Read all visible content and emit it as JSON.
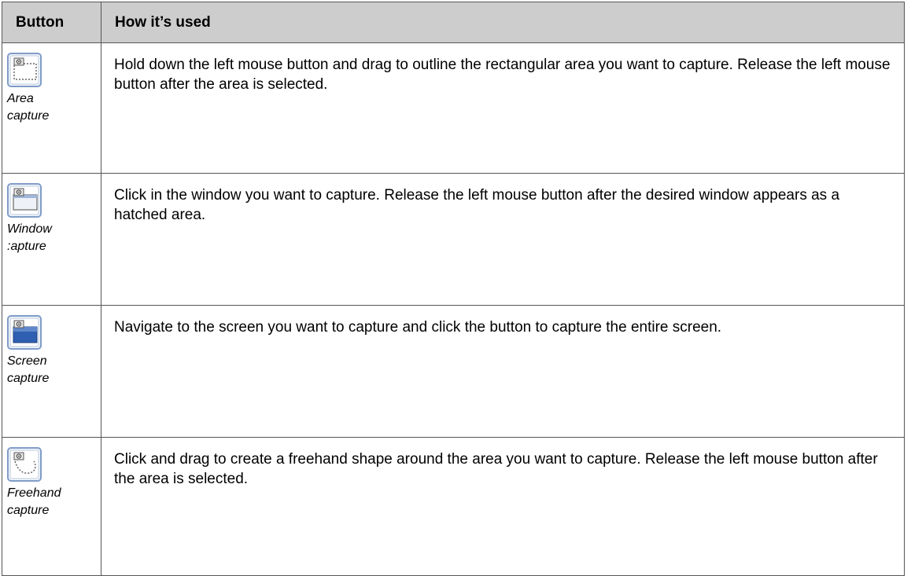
{
  "table": {
    "headers": {
      "button": "Button",
      "usage": "How it’s used"
    },
    "rows": [
      {
        "icon": "area-capture-icon",
        "caption": "Area\ncapture",
        "description": "Hold down the left mouse button and drag to outline the rectangular area you want to capture. Release the left mouse button after the area is selected."
      },
      {
        "icon": "window-capture-icon",
        "caption": " Window\n:apture",
        "description": "Click in the window you want to capture. Release the left mouse button after the desired window appears as a hatched area."
      },
      {
        "icon": "screen-capture-icon",
        "caption": "Screen\ncapture",
        "description": "Navigate to the screen you want to capture and click the button to capture the entire screen."
      },
      {
        "icon": "freehand-capture-icon",
        "caption": "Freehand\ncapture",
        "description": "Click and drag to create a freehand shape around the area you want to capture. Release the left mouse button after the area is selected."
      }
    ]
  },
  "colors": {
    "header_bg": "#cdcdcd",
    "border": "#555555",
    "icon_frame": "#4a78b8",
    "icon_fill": "#2f5fb0"
  }
}
